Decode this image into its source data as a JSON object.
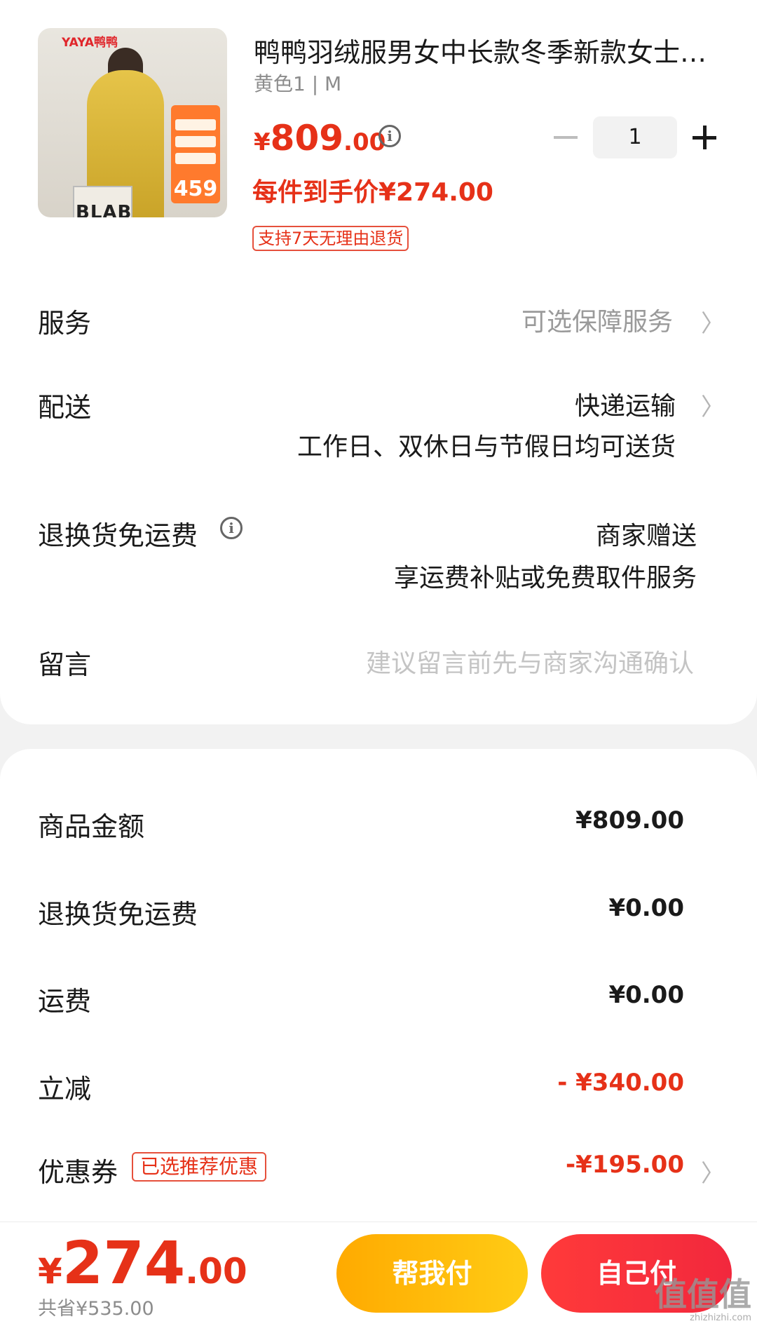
{
  "product": {
    "image_brand": "YAYA鸭鸭",
    "image_bag_text": "BLAB",
    "image_promo_price": "459",
    "title": "鸭鸭羽绒服男女中长款冬季新款女士保暖加厚外套",
    "spec": "黄色1 | M",
    "price_yen": "¥",
    "price_int": "809",
    "price_dec": ".00",
    "per_item_price": "每件到手价¥274.00",
    "return_tag": "支持7天无理由退货",
    "quantity": "1"
  },
  "rows": {
    "service_label": "服务",
    "service_value": "可选保障服务",
    "delivery_label": "配送",
    "delivery_value": "快递运输",
    "delivery_note": "工作日、双休日与节假日均可送货",
    "return_fee_label": "退换货免运费",
    "return_fee_value": "商家赠送",
    "return_fee_note": "享运费补贴或免费取件服务",
    "message_label": "留言",
    "message_placeholder": "建议留言前先与商家沟通确认"
  },
  "summary": {
    "goods_amount_label": "商品金额",
    "goods_amount_value": "¥809.00",
    "return_fee_label": "退换货免运费",
    "return_fee_value": "¥0.00",
    "shipping_label": "运费",
    "shipping_value": "¥0.00",
    "instant_discount_label": "立减",
    "instant_discount_value": "- ¥340.00",
    "coupon_label": "优惠券",
    "coupon_tag": "已选推荐优惠",
    "coupon_value": "-¥195.00"
  },
  "bottom_bar": {
    "total_yen": "¥",
    "total_int": "274",
    "total_dec": ".00",
    "saved": "共省¥535.00",
    "help_pay_label": "帮我付",
    "self_pay_label": "自己付"
  },
  "watermark": {
    "glyphs": "值值值",
    "url": "zhizhizhi.com"
  },
  "colors": {
    "accent_red": "#e63118",
    "help_button": "#ffb800",
    "self_button": "#f2283d"
  }
}
